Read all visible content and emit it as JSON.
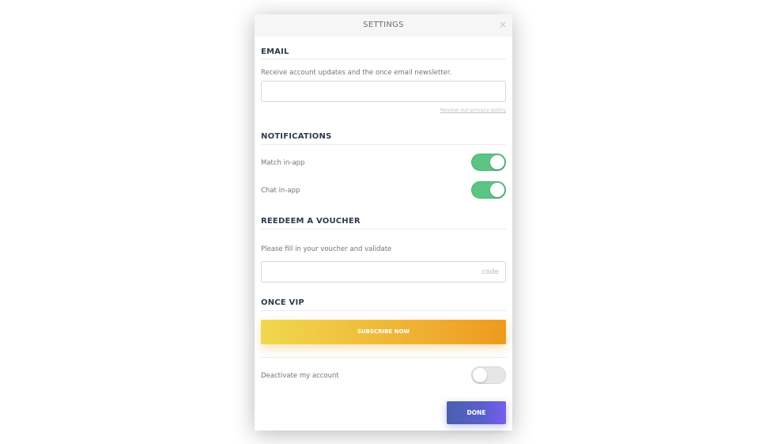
{
  "modal": {
    "title": "SETTINGS",
    "close_icon": "×"
  },
  "email": {
    "heading": "EMAIL",
    "description": "Receive account updates and the once email newsletter.",
    "value": "",
    "privacy_link": "Review our privacy policy"
  },
  "notifications": {
    "heading": "NOTIFICATIONS",
    "match_label": "Match in-app",
    "match_enabled": true,
    "chat_label": "Chat in-app",
    "chat_enabled": true
  },
  "voucher": {
    "heading": "REEDEEM A VOUCHER",
    "description": "Please fill in your voucher and validate",
    "placeholder": "code"
  },
  "vip": {
    "heading": "ONCE VIP",
    "subscribe_label": "SUBSCRIBE NOW"
  },
  "account": {
    "deactivate_label": "Deactivate my account",
    "deactivate_enabled": false
  },
  "footer": {
    "done_label": "DONE"
  },
  "colors": {
    "toggle_on": "#5cc584",
    "toggle_off": "#e6e6e6",
    "subscribe_gradient_start": "#f0d84e",
    "subscribe_gradient_end": "#ee9a1e",
    "done_gradient_start": "#4a5fad",
    "done_gradient_end": "#7a5ef0",
    "heading": "#2f3a4d"
  }
}
